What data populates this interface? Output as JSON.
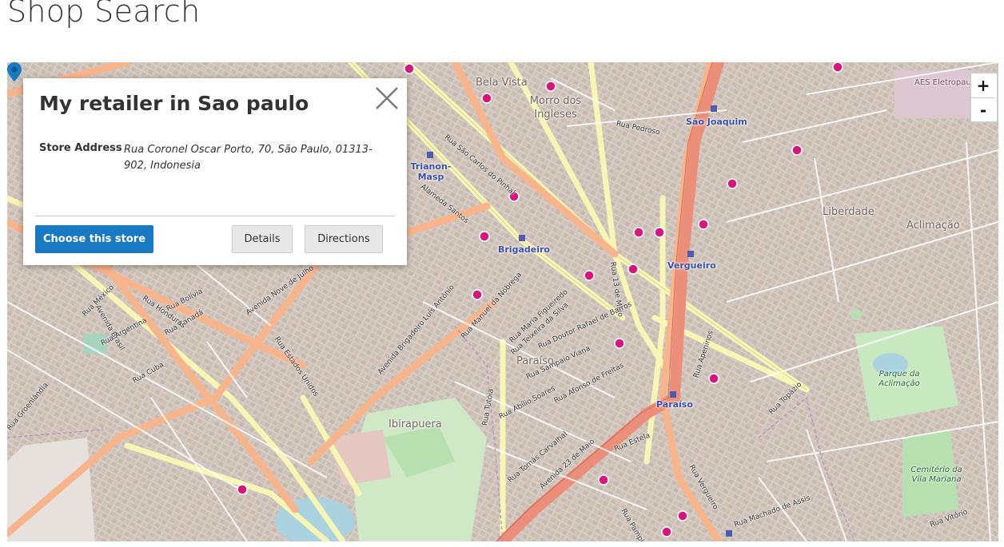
{
  "page": {
    "title": "Shop Search"
  },
  "map": {
    "zoom_in_label": "+",
    "zoom_out_label": "-",
    "districts": [
      "Bela Vista",
      "Morro dos Ingleses",
      "Liberdade",
      "Aclimação",
      "Paraíso",
      "Ibirapuera"
    ],
    "stations": [
      "São Joaquim",
      "Trianon-Masp",
      "Brigadeiro",
      "Vergueiro",
      "Paraíso"
    ],
    "parks": [
      "Parque da Aclimação",
      "Cemitério da Vila Mariana"
    ],
    "pois": [
      "AES Eletropaulo"
    ],
    "streets": [
      "Rua Pedroso",
      "Alameda Santos",
      "Rua São Carlos do Pinhal",
      "Avenida Brigadeiro Luís Antônio",
      "Rua Manuel da Nóbrega",
      "Rua Maria Figueiredo",
      "Rua Teixeira da Silva",
      "Avenida Brasil",
      "Rua Estados Unidos",
      "Avenida Nove de Julho",
      "Rua Groenlândia",
      "Avenida 23 de Maio",
      "Rua Vergueiro",
      "Rua 13 de Maio",
      "Rua Tomás Carvalhal",
      "Rua Tutóia",
      "Rua Abílio Soares",
      "Rua Topázio",
      "Rua Afonso de Freitas",
      "Rua Doutor Rafael de Barros",
      "Rua Sampaio Viana",
      "Rua Apeninos",
      "Rua Machado de Assis",
      "Rua Vitório",
      "Rua Bolívia",
      "Rua Argentina",
      "Rua Canadá",
      "Rua México",
      "Rua Honduras",
      "Rua Cuba",
      "Rua Pamplona",
      "Rua Estela"
    ],
    "colors": {
      "land": "#d9cfc6",
      "major_road": "#f8b48b",
      "secondary_road": "#f7f6b5",
      "trunk": "#eb8f7a",
      "park": "#c8e9c0",
      "water": "#aad3df",
      "pharmacy": "#d8157d",
      "station": "#4e5bb0"
    }
  },
  "store_popup": {
    "name": "My retailer in Sao paulo",
    "address_label": "Store Address",
    "address": "Rua Coronel Oscar Porto, 70, São Paulo, 01313-902, Indonesia",
    "choose_label": "Choose this store",
    "details_label": "Details",
    "directions_label": "Directions"
  }
}
